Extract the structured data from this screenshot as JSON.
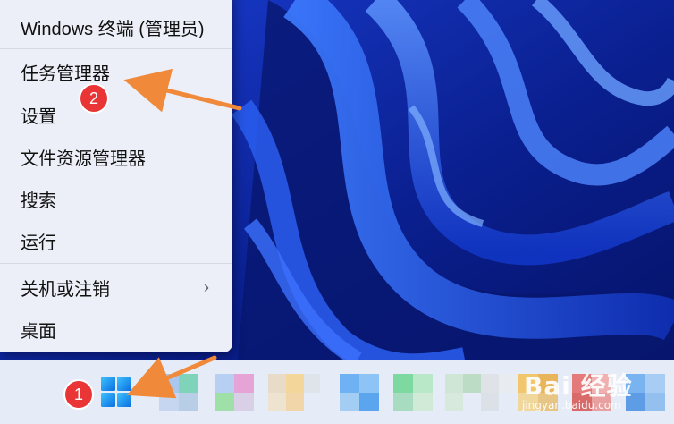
{
  "context_menu": {
    "items": [
      {
        "label": "Windows 终端 (管理员)"
      },
      {
        "label": "任务管理器"
      },
      {
        "label": "设置"
      },
      {
        "label": "文件资源管理器"
      },
      {
        "label": "搜索"
      },
      {
        "label": "运行"
      },
      {
        "label": "关机或注销",
        "submenu": true
      },
      {
        "label": "桌面"
      }
    ],
    "submenu_chevron": "›"
  },
  "annotations": {
    "badge1": "1",
    "badge2": "2",
    "badge_color": "#e93535",
    "arrow_color": "#f08a3a"
  },
  "taskbar": {
    "start_icon": "windows-start-icon"
  },
  "watermark": {
    "main": "Bai 经验",
    "sub": "jingyan.baidu.com"
  },
  "colors": {
    "wallpaper_dark": "#0a1f8f",
    "wallpaper_light": "#2f6bff",
    "menu_bg": "#eceff8",
    "taskbar_bg": "#e6ecf7"
  }
}
